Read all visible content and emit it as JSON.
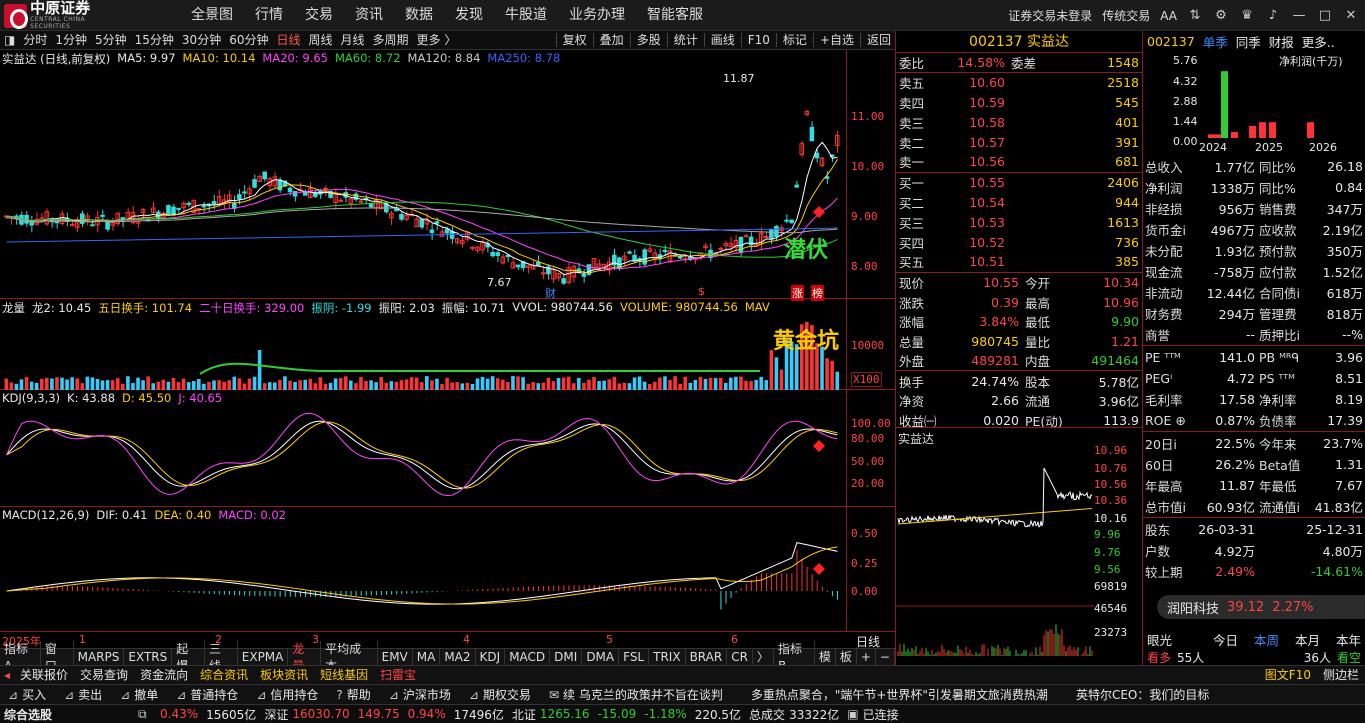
{
  "brand": {
    "name_cn": "中原证券",
    "name_en": "CENTRAL CHINA SECURITIES"
  },
  "nav": [
    "全景图",
    "行情",
    "交易",
    "资讯",
    "数据",
    "发现",
    "牛股道",
    "业务办理",
    "智能客服"
  ],
  "topright": {
    "login": "证券交易未登录",
    "mode": "传统交易",
    "fontsize": "AA"
  },
  "periods": [
    "分时",
    "1分钟",
    "5分钟",
    "15分钟",
    "30分钟",
    "60分钟",
    "日线",
    "周线",
    "月线",
    "多周期",
    "更多 〉"
  ],
  "period_selected": "日线",
  "tools": [
    "复权",
    "叠加",
    "多股",
    "统计",
    "画线",
    "F10",
    "标记",
    "+自选",
    "返回"
  ],
  "legend_main": {
    "title": "实益达 (日线,前复权)",
    "ma5": "MA5: 9.97",
    "ma10": "MA10: 10.14",
    "ma20": "MA20: 9.65",
    "ma60": "MA60: 8.72",
    "ma120": "MA120: 8.84",
    "ma250": "MA250: 8.78"
  },
  "main_y": [
    "11.00",
    "10.00",
    "9.00",
    "8.00"
  ],
  "main_labels": {
    "high": "11.87",
    "low": "7.67",
    "caiwu": "财",
    "s": "$",
    "zhang": "涨",
    "bang": "榜",
    "qianfu": "潜伏"
  },
  "legend_vol": {
    "title": "龙量",
    "l2": "龙2: 10.45",
    "w5": "五日换手: 101.74",
    "w20": "二十日换手: 329.00",
    "zy": "振阴: -1.99",
    "zyang": "振阳: 2.03",
    "zf": "振幅: 10.71",
    "vvol": "VVOL: 980744.56",
    "volume": "VOLUME: 980744.56",
    "mav": "MAV"
  },
  "vol_y": {
    "v": "10000",
    "x": "X100"
  },
  "vol_label": "黄金坑",
  "legend_kdj": {
    "title": "KDJ(9,3,3)",
    "k": "K: 43.88",
    "d": "D: 45.50",
    "j": "J: 40.65"
  },
  "kdj_y": [
    "100.00",
    "80.00",
    "50.00",
    "20.00"
  ],
  "legend_macd": {
    "title": "MACD(12,26,9)",
    "dif": "DIF: 0.41",
    "dea": "DEA: 0.40",
    "macd": "MACD: 0.02"
  },
  "macd_y": [
    "0.50",
    "0.25",
    "0.00"
  ],
  "xaxis": {
    "year": "2025年",
    "m1": "1",
    "m2": "2",
    "m3": "3",
    "m4": "4",
    "m5": "5",
    "m6": "6",
    "period": "日线"
  },
  "indicator_tabs": [
    "指标A",
    "窗口",
    "MARPS",
    "EXTRS",
    "起爆",
    "三线",
    "EXPMA",
    "龙量",
    "平均成本",
    "EMV",
    "MA",
    "MA2",
    "KDJ",
    "MACD",
    "DMI",
    "DMA",
    "FSL",
    "TRIX",
    "BRAR",
    "CR",
    "〉",
    "指标B",
    "模",
    "板",
    "+",
    "−"
  ],
  "indicator_active": "龙量",
  "quote": {
    "code": "002137",
    "name": "实益达",
    "weibi": "委比",
    "weibi_v": "14.58%",
    "weicha": "委差",
    "weicha_v": "1548",
    "asks": [
      {
        "k": "卖五",
        "p": "10.60",
        "v": "2518"
      },
      {
        "k": "卖四",
        "p": "10.59",
        "v": "545"
      },
      {
        "k": "卖三",
        "p": "10.58",
        "v": "401"
      },
      {
        "k": "卖二",
        "p": "10.57",
        "v": "391"
      },
      {
        "k": "卖一",
        "p": "10.56",
        "v": "681"
      }
    ],
    "bids": [
      {
        "k": "买一",
        "p": "10.55",
        "v": "2406"
      },
      {
        "k": "买二",
        "p": "10.54",
        "v": "944"
      },
      {
        "k": "买三",
        "p": "10.53",
        "v": "1613"
      },
      {
        "k": "买四",
        "p": "10.52",
        "v": "736"
      },
      {
        "k": "买五",
        "p": "10.51",
        "v": "385"
      }
    ],
    "stats": [
      {
        "k": "现价",
        "v": "10.55",
        "c": "red",
        "k2": "今开",
        "v2": "10.34",
        "c2": "red"
      },
      {
        "k": "涨跌",
        "v": "0.39",
        "c": "red",
        "k2": "最高",
        "v2": "10.96",
        "c2": "red"
      },
      {
        "k": "涨幅",
        "v": "3.84%",
        "c": "red",
        "k2": "最低",
        "v2": "9.90",
        "c2": "grn"
      },
      {
        "k": "总量",
        "v": "980745",
        "c": "yel",
        "k2": "量比",
        "v2": "1.21",
        "c2": "red"
      },
      {
        "k": "外盘",
        "v": "489281",
        "c": "red",
        "k2": "内盘",
        "v2": "491464",
        "c2": "grn"
      }
    ],
    "stats2": [
      {
        "k": "换手",
        "v": "24.74%",
        "k2": "股本",
        "v2": "5.78亿"
      },
      {
        "k": "净资",
        "v": "2.66",
        "k2": "流通",
        "v2": "3.96亿"
      },
      {
        "k": "收益㈠",
        "v": "0.020",
        "k2": "PE(动)",
        "v2": "113.9"
      }
    ]
  },
  "intraday": {
    "title": "实益达",
    "y": [
      "10.96",
      "10.76",
      "10.56",
      "10.36",
      "10.16",
      "9.96",
      "9.76",
      "9.56",
      "69819",
      "46546",
      "23273"
    ]
  },
  "fin": {
    "code": "002137",
    "tabs": [
      "单季",
      "同季",
      "财报",
      "更多.."
    ],
    "chart_label": "净利润(千万)",
    "chart_y": [
      "5.76",
      "4.32",
      "2.88",
      "1.44",
      "0.00"
    ],
    "chart_x": [
      "2024",
      "2025",
      "2026"
    ],
    "rows": [
      {
        "k": "总收入",
        "v": "1.77亿",
        "c": "wht",
        "k2": "同比%",
        "v2": "26.18",
        "c2": "wht"
      },
      {
        "k": "净利润",
        "v": "1338万",
        "c": "wht",
        "k2": "同比%",
        "v2": "0.84",
        "c2": "wht"
      },
      {
        "k": "非经损",
        "v": "956万",
        "c": "wht",
        "k2": "销售费",
        "v2": "347万",
        "c2": "wht"
      },
      {
        "k": "货币金ⅰ",
        "v": "4967万",
        "c": "wht",
        "k2": "应收款",
        "v2": "2.19亿",
        "c2": "wht"
      },
      {
        "k": "未分配",
        "v": "1.93亿",
        "c": "wht",
        "k2": "预付款",
        "v2": "350万",
        "c2": "wht"
      },
      {
        "k": "现金流",
        "v": "-758万",
        "c": "wht",
        "k2": "应付款",
        "v2": "1.52亿",
        "c2": "wht"
      },
      {
        "k": "非流动",
        "v": "12.44亿",
        "c": "wht",
        "k2": "合同债ⅰ",
        "v2": "618万",
        "c2": "wht"
      },
      {
        "k": "财务费",
        "v": "294万",
        "c": "wht",
        "k2": "管理费",
        "v2": "818万",
        "c2": "wht"
      },
      {
        "k": "商誉",
        "v": "--",
        "c": "wht",
        "k2": "质押比ⅰ",
        "v2": "--%",
        "c2": "wht"
      }
    ],
    "rows2": [
      {
        "k": "PE ᵀᵀᴹ",
        "v": "141.0",
        "k2": "PB ᴹᴿᑫ",
        "v2": "3.96"
      },
      {
        "k": "PEGⁱ",
        "v": "4.72",
        "k2": "PS ᵀᵀᴹ",
        "v2": "8.51"
      },
      {
        "k": "毛利率",
        "v": "17.58",
        "k2": "净利率",
        "v2": "8.19"
      },
      {
        "k": "ROE ⊕",
        "v": "0.87%",
        "k2": "负债率",
        "v2": "17.39"
      }
    ],
    "rows3": [
      {
        "k": "20日ⅰ",
        "v": "22.5%",
        "k2": "今年来",
        "v2": "23.7%"
      },
      {
        "k": "60日",
        "v": "26.2%",
        "k2": "Beta值",
        "v2": "1.31"
      },
      {
        "k": "年最高",
        "v": "11.87",
        "k2": "年最低",
        "v2": "7.67"
      },
      {
        "k": "总市值ⅰ",
        "v": "60.93亿",
        "k2": "流通值ⅰ",
        "v2": "41.83亿"
      }
    ],
    "rows4": [
      {
        "k": "股东",
        "v": "26-03-31",
        "k2": "",
        "v2": "25-12-31"
      },
      {
        "k": "户数",
        "v": "4.92万",
        "k2": "",
        "v2": "4.80万"
      },
      {
        "k": "较上期",
        "v": "2.49%",
        "k2": "",
        "v2": "-14.61%"
      }
    ],
    "popup": {
      "name": "润阳科技",
      "price": "39.12",
      "pct": "2.27%"
    },
    "eye": {
      "title": "眼光",
      "tabs": [
        "今日",
        "本周",
        "本月",
        "本年"
      ],
      "active": "本周",
      "r1k": "看多",
      "r1v": "55人",
      "r2v": "36人",
      "r2k": "看空"
    }
  },
  "quote_tabs": [
    "笔",
    "价",
    "细",
    "势",
    "联",
    "值",
    "主",
    "逆",
    "筹"
  ],
  "quote_tab_active": "势",
  "brow1": [
    "关联报价",
    "交易查询",
    "资金流向",
    "综合资讯",
    "板块资讯",
    "短线基因",
    "扫雷宝"
  ],
  "brow1_right": {
    "f10": "图文F10",
    "side": "侧边栏"
  },
  "brow2": [
    "买入",
    "卖出",
    "撤单",
    "普通持仓",
    "信用持仓",
    "帮助",
    "沪深市场",
    "期权交易"
  ],
  "news": [
    "续 乌克兰的政策并不旨在谈判",
    "多重热点聚合，\"端午节+世界杯\"引发暑期文旅消费热潮",
    "英特尔CEO：我们的目标"
  ],
  "ticker": {
    "title": "综合选股",
    "pct1": "0.43%",
    "amt1": "15605亿",
    "sz": "深证",
    "sz_v": "16030.70",
    "sz_c": "149.75",
    "sz_p": "0.94%",
    "amt2": "17496亿",
    "bz": "北证",
    "bz_v": "1265.16",
    "bz_c": "-15.09",
    "bz_p": "-1.18%",
    "amt3": "220.5亿",
    "zc": "总成交",
    "zc_v": "33322亿",
    "conn": "已连接"
  }
}
